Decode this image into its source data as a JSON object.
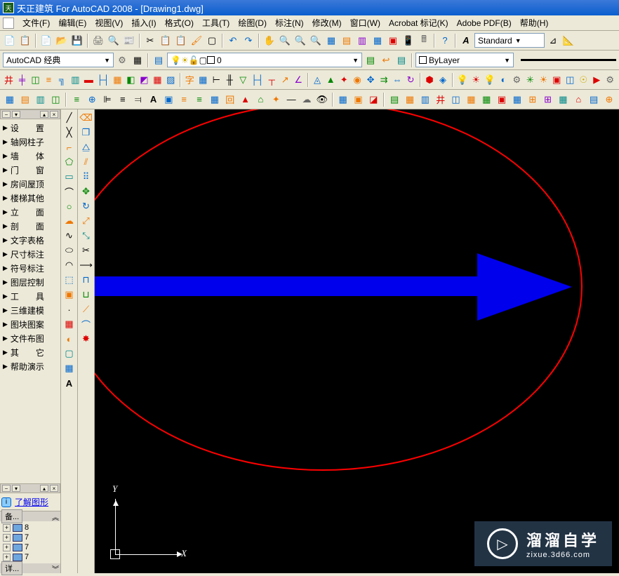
{
  "title": "天正建筑 For AutoCAD 2008 - [Drawing1.dwg]",
  "menu": [
    "文件(F)",
    "编辑(E)",
    "视图(V)",
    "插入(I)",
    "格式(O)",
    "工具(T)",
    "绘图(D)",
    "标注(N)",
    "修改(M)",
    "窗口(W)",
    "Acrobat 标记(K)",
    "Adobe PDF(B)",
    "帮助(H)"
  ],
  "workspace": "AutoCAD 经典",
  "layer_current": "0",
  "linetype_current": "ByLayer",
  "text_style": "Standard",
  "sidebar_items": [
    "设　　置",
    "轴网柱子",
    "墙　　体",
    "门　　窗",
    "房间屋顶",
    "楼梯其他",
    "立　　面",
    "剖　　面",
    "文字表格",
    "尺寸标注",
    "符号标注",
    "图层控制",
    "工　　具",
    "三维建模",
    "图块图案",
    "文件布图",
    "其　　它",
    "帮助演示"
  ],
  "link_text": "了解图形",
  "backup_tab": "备...",
  "detail_tab": "详...",
  "tree_items": [
    "8",
    "7",
    "7",
    "7"
  ],
  "ucs": {
    "x": "X",
    "y": "Y"
  },
  "watermark": {
    "title": "溜溜自学",
    "sub": "zixue.3d66.com"
  },
  "scroll_arrows": {
    "up": "︽",
    "down": "︾"
  }
}
